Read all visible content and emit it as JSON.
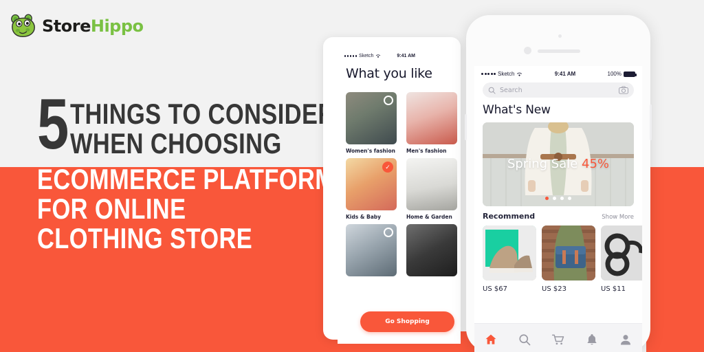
{
  "brand": {
    "name_part1": "Store",
    "name_part2": "Hippo",
    "logo_icon": "hippo-mascot-icon",
    "green": "#7ac143",
    "dark": "#1d1d1b"
  },
  "theme": {
    "accent_orange": "#f9573a",
    "background_gray": "#f2f2f2",
    "headline_dark": "#373737",
    "headline_light": "#ffffff"
  },
  "headline": {
    "number": "5",
    "line1": "THINGS TO CONSIDER",
    "line2": "WHEN CHOOSING",
    "line3": "ECOMMERCE PLATFORM",
    "line4": "FOR ONLINE",
    "line5": "CLOTHING STORE"
  },
  "phone_left": {
    "status": {
      "carrier": "Sketch",
      "time": "9:41 AM",
      "wifi_icon": "wifi-icon"
    },
    "title": "What you like",
    "categories": [
      {
        "label": "Women's fashion",
        "selected": false,
        "photo": "woman-in-denim-jacket"
      },
      {
        "label": "Men's fashion",
        "selected": false,
        "photo": "man-in-pink-shirt-and-hat"
      },
      {
        "label": "Kids & Baby",
        "selected": true,
        "photo": "baby-with-yellow-hat-eating"
      },
      {
        "label": "Home & Garden",
        "selected": false,
        "photo": "living-room-interior"
      },
      {
        "label": "",
        "selected": false,
        "photo": "smart-watch-on-wrist"
      },
      {
        "label": "",
        "selected": false,
        "photo": "black-sneakers"
      }
    ],
    "cta_label": "Go Shopping"
  },
  "phone_right": {
    "status": {
      "carrier": "Sketch",
      "time": "9:41 AM",
      "battery_percent": "100%",
      "wifi_icon": "wifi-icon",
      "battery_icon": "battery-full-icon"
    },
    "search": {
      "placeholder": "Search",
      "search_icon": "search-icon",
      "camera_icon": "camera-icon"
    },
    "title": "What's New",
    "hero": {
      "text": "Spring Sale ",
      "discount": "45%",
      "photo": "woman-in-white-coat-with-belt",
      "dots_total": 4,
      "dots_active_index": 0
    },
    "recommend": {
      "title": "Recommend",
      "show_more": "Show More",
      "products": [
        {
          "price": "US $67",
          "photo": "tan-sneakers-on-teal"
        },
        {
          "price": "US $23",
          "photo": "blue-leather-messenger-bag"
        },
        {
          "price": "US $11",
          "photo": "black-round-sunglasses"
        }
      ]
    },
    "tabbar": [
      {
        "icon": "home-icon",
        "active": true
      },
      {
        "icon": "search-icon",
        "active": false
      },
      {
        "icon": "cart-icon",
        "active": false
      },
      {
        "icon": "bell-icon",
        "active": false
      },
      {
        "icon": "profile-icon",
        "active": false
      }
    ]
  }
}
